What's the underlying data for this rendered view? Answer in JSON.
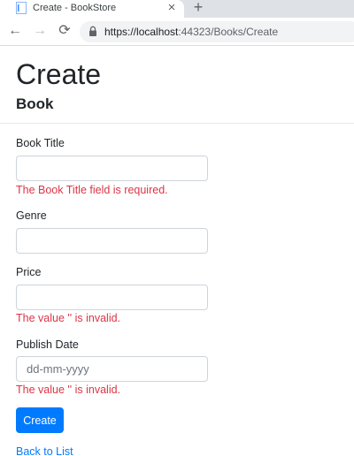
{
  "browser": {
    "tab_title": "Create - BookStore",
    "tab_close": "×",
    "new_tab": "+",
    "url_prefix": "https://",
    "url_host": "localhost",
    "url_rest": ":44323/Books/Create",
    "back_icon": "←",
    "forward_icon": "→",
    "reload_icon": "⟳"
  },
  "page": {
    "title": "Create",
    "subtitle": "Book"
  },
  "form": {
    "book_title_label": "Book Title",
    "book_title_value": "",
    "book_title_error": "The Book Title field is required.",
    "genre_label": "Genre",
    "genre_value": "",
    "price_label": "Price",
    "price_value": "",
    "price_error": "The value '' is invalid.",
    "publish_date_label": "Publish Date",
    "publish_date_placeholder": "dd-mm-yyyy",
    "publish_date_error": "The value '' is invalid.",
    "submit_label": "Create"
  },
  "links": {
    "back_to_list": "Back to List"
  },
  "colors": {
    "accent": "#007bff",
    "error": "#dc3545"
  }
}
